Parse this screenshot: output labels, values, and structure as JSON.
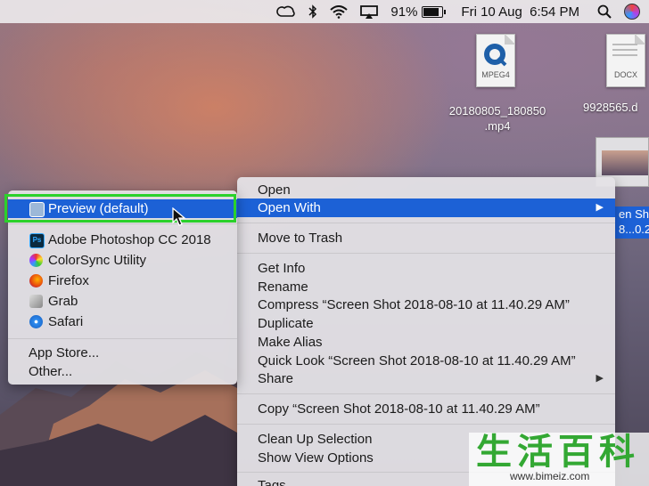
{
  "menubar": {
    "battery_percent": "91%",
    "battery_level": 0.91,
    "datetime": "Fri 10 Aug  6:54 PM",
    "icons": [
      "creative-cloud-icon",
      "bluetooth-icon",
      "wifi-icon",
      "airplay-icon",
      "battery-icon",
      "spotlight-search-icon",
      "siri-icon"
    ]
  },
  "desktop": {
    "files": [
      {
        "badge": "MPEG4",
        "name_line1": "20180805_180850",
        "name_line2": ".mp4"
      },
      {
        "badge": "DOCX",
        "name_line1": "9928565.d"
      }
    ],
    "selected_label_line1": "en Sh",
    "selected_label_line2": "8...0.2"
  },
  "context_menu": {
    "open": "Open",
    "open_with": "Open With",
    "move_to_trash": "Move to Trash",
    "get_info": "Get Info",
    "rename": "Rename",
    "compress": "Compress “Screen Shot 2018-08-10 at 11.40.29 AM”",
    "duplicate": "Duplicate",
    "make_alias": "Make Alias",
    "quick_look": "Quick Look “Screen Shot 2018-08-10 at 11.40.29 AM”",
    "share": "Share",
    "copy": "Copy “Screen Shot 2018-08-10 at 11.40.29 AM”",
    "clean_up": "Clean Up Selection",
    "show_view_options": "Show View Options",
    "tags": "Tags...",
    "submenu_arrow": "▶"
  },
  "open_with_menu": {
    "preview": "Preview (default)",
    "photoshop": "Adobe Photoshop CC 2018",
    "colorsync": "ColorSync Utility",
    "firefox": "Firefox",
    "grab": "Grab",
    "safari": "Safari",
    "app_store": "App Store...",
    "other": "Other..."
  },
  "watermark": {
    "chars": "生活百科",
    "url": "www.bimeiz.com"
  },
  "colors": {
    "highlight": "#1c61d6",
    "green_outline": "#2bd12b"
  }
}
